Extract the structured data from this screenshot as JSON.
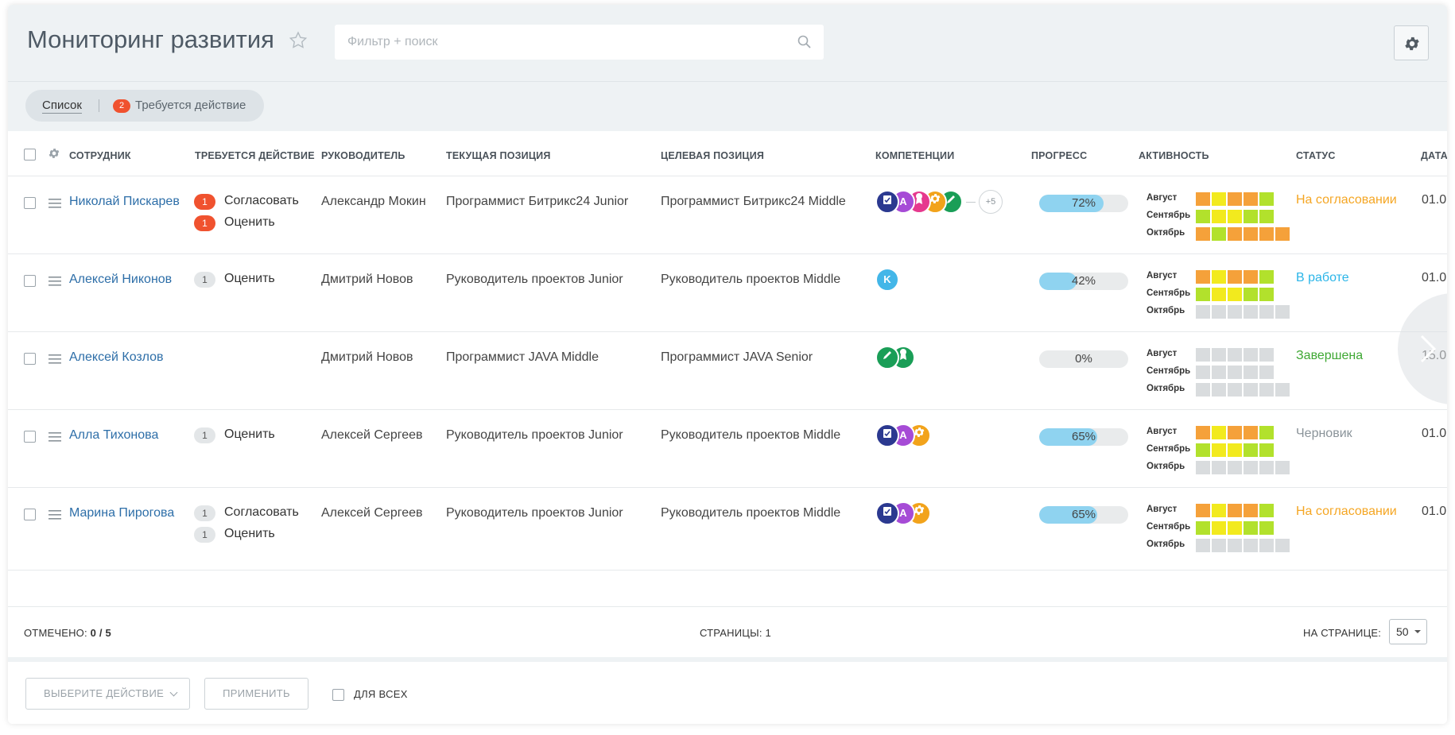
{
  "header": {
    "title": "Мониторинг развития",
    "search_placeholder": "Фильтр + поиск"
  },
  "toolbar": {
    "tab_list": "Список",
    "tab_action_count": "2",
    "tab_action": "Требуется действие"
  },
  "columns": {
    "employee": "СОТРУДНИК",
    "action": "ТРЕБУЕТСЯ ДЕЙСТВИЕ",
    "manager": "РУКОВОДИТЕЛЬ",
    "current": "ТЕКУЩАЯ ПОЗИЦИЯ",
    "target": "ЦЕЛЕВАЯ ПОЗИЦИЯ",
    "competencies": "КОМПЕТЕНЦИИ",
    "progress": "ПРОГРЕСС",
    "activity": "АКТИВНОСТЬ",
    "status": "СТАТУС",
    "date": "ДАТА"
  },
  "months": [
    "Август",
    "Сентябрь",
    "Октябрь"
  ],
  "colors": {
    "activity": {
      "o": "#f5a13a",
      "y": "#f2ea1e",
      "g": "#b2e12c",
      "n": "#d9dcde"
    },
    "status": {
      "approval": "#f5a623",
      "work": "#2bb5e8",
      "done": "#3fa834",
      "draft": "#8a9399"
    },
    "competency": {
      "check": "#2b3990",
      "a": "#a64bd6",
      "medal": "#e6398e",
      "gear": "#f2a31b",
      "pencil": "#1a9e57",
      "k": "#43b6e8"
    }
  },
  "rows": [
    {
      "name": "Николай Пискарев",
      "actions": [
        {
          "count": "1",
          "label": "Согласовать",
          "tone": "red"
        },
        {
          "count": "1",
          "label": "Оценить",
          "tone": "red"
        }
      ],
      "manager": "Александр Мокин",
      "current": "Программист Битрикс24 Junior",
      "target": "Программист Битрикс24 Middle",
      "competencies": [
        {
          "icon": "check-icon",
          "c": "check"
        },
        {
          "icon": "letter-a-icon",
          "text": "A",
          "c": "a"
        },
        {
          "icon": "medal-icon",
          "c": "medal"
        },
        {
          "icon": "gear-icon",
          "c": "gear"
        },
        {
          "icon": "pencil-icon",
          "c": "pencil"
        }
      ],
      "competencies_more": "+5",
      "progress": 0.72,
      "progress_text": "72%",
      "activity": [
        [
          "o",
          "y",
          "o",
          "o",
          "g"
        ],
        [
          "g",
          "y",
          "y",
          "g",
          "g"
        ],
        [
          "o",
          "g",
          "o",
          "o",
          "o",
          "o"
        ]
      ],
      "status": "На согласовании",
      "status_kind": "approval",
      "date": "01.0"
    },
    {
      "name": "Алексей Никонов",
      "actions": [
        {
          "count": "1",
          "label": "Оценить",
          "tone": "gray"
        }
      ],
      "manager": "Дмитрий Новов",
      "current": "Руководитель проектов Junior",
      "target": "Руководитель проектов Middle",
      "competencies": [
        {
          "icon": "letter-k-icon",
          "text": "K",
          "c": "k"
        }
      ],
      "progress": 0.42,
      "progress_text": "42%",
      "activity": [
        [
          "o",
          "y",
          "o",
          "o",
          "g"
        ],
        [
          "g",
          "y",
          "y",
          "g",
          "g"
        ],
        [
          "n",
          "n",
          "n",
          "n",
          "n",
          "n"
        ]
      ],
      "status": "В работе",
      "status_kind": "work",
      "date": "01.0"
    },
    {
      "name": "Алексей Козлов",
      "actions": [],
      "manager": "Дмитрий Новов",
      "current": "Программист JAVA Middle",
      "target": "Программист JAVA Senior",
      "competencies": [
        {
          "icon": "pencil-icon",
          "c": "pencil"
        },
        {
          "icon": "medal-icon",
          "c": "pencil"
        }
      ],
      "progress": 0,
      "progress_text": "0%",
      "activity": [
        [
          "n",
          "n",
          "n",
          "n",
          "n"
        ],
        [
          "n",
          "n",
          "n",
          "n",
          "n"
        ],
        [
          "n",
          "n",
          "n",
          "n",
          "n",
          "n"
        ]
      ],
      "status": "Завершена",
      "status_kind": "done",
      "date": "15.0"
    },
    {
      "name": "Алла Тихонова",
      "actions": [
        {
          "count": "1",
          "label": "Оценить",
          "tone": "gray"
        }
      ],
      "manager": "Алексей Сергеев",
      "current": "Руководитель проектов Junior",
      "target": "Руководитель проектов Middle",
      "competencies": [
        {
          "icon": "check-icon",
          "c": "check"
        },
        {
          "icon": "letter-a-icon",
          "text": "A",
          "c": "a"
        },
        {
          "icon": "gear-icon",
          "c": "gear"
        }
      ],
      "progress": 0.65,
      "progress_text": "65%",
      "activity": [
        [
          "o",
          "y",
          "o",
          "o",
          "g"
        ],
        [
          "g",
          "y",
          "y",
          "g",
          "g"
        ],
        [
          "n",
          "n",
          "n",
          "n",
          "n",
          "n"
        ]
      ],
      "status": "Черновик",
      "status_kind": "draft",
      "date": "01.0"
    },
    {
      "name": "Марина Пирогова",
      "actions": [
        {
          "count": "1",
          "label": "Согласовать",
          "tone": "gray"
        },
        {
          "count": "1",
          "label": "Оценить",
          "tone": "gray"
        }
      ],
      "manager": "Алексей Сергеев",
      "current": "Руководитель проектов Junior",
      "target": "Руководитель проектов Middle",
      "competencies": [
        {
          "icon": "check-icon",
          "c": "check"
        },
        {
          "icon": "letter-a-icon",
          "text": "A",
          "c": "a"
        },
        {
          "icon": "gear-icon",
          "c": "gear"
        }
      ],
      "progress": 0.65,
      "progress_text": "65%",
      "activity": [
        [
          "o",
          "y",
          "o",
          "o",
          "g"
        ],
        [
          "g",
          "y",
          "y",
          "g",
          "g"
        ],
        [
          "n",
          "n",
          "n",
          "n",
          "n",
          "n"
        ]
      ],
      "status": "На согласовании",
      "status_kind": "approval",
      "date": "01.0"
    }
  ],
  "footer": {
    "selected_label": "ОТМЕЧЕНО:",
    "selected_value": "0 / 5",
    "pages": "СТРАНИЦЫ: 1",
    "per_page_label": "НА СТРАНИЦЕ:",
    "per_page_value": "50"
  },
  "bottom": {
    "select_action": "ВЫБЕРИТЕ ДЕЙСТВИЕ",
    "apply": "ПРИМЕНИТЬ",
    "for_all": "ДЛЯ ВСЕХ"
  }
}
